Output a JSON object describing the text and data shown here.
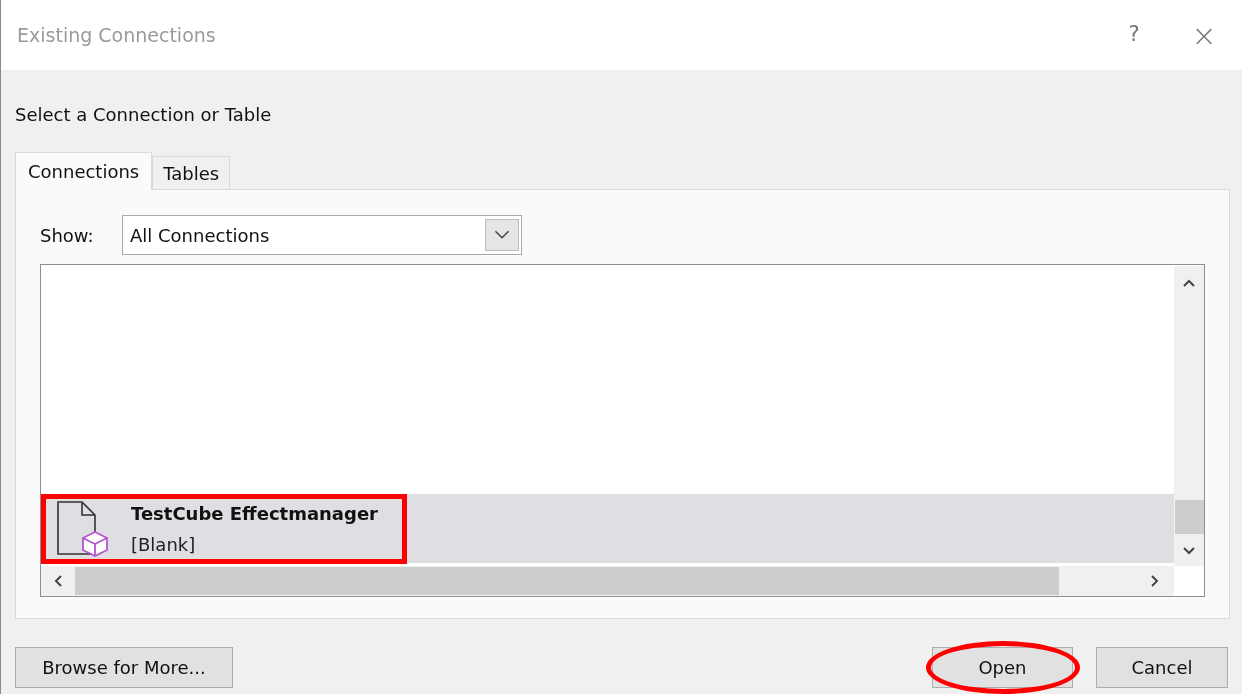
{
  "window": {
    "title": "Existing Connections",
    "help": "?",
    "close": "×"
  },
  "heading": "Select a Connection or Table",
  "tabs": [
    {
      "label": "Connections",
      "selected": true
    },
    {
      "label": "Tables",
      "selected": false
    }
  ],
  "show": {
    "label": "Show:",
    "value": "All Connections"
  },
  "connections": [
    {
      "name": "TestCube Effectmanager",
      "detail": "[Blank]",
      "selected": true,
      "annotated": true
    }
  ],
  "buttons": [
    {
      "label": "Browse for More...",
      "annotated": false
    },
    {
      "label": "Open",
      "annotated": true
    },
    {
      "label": "Cancel",
      "annotated": false
    }
  ]
}
